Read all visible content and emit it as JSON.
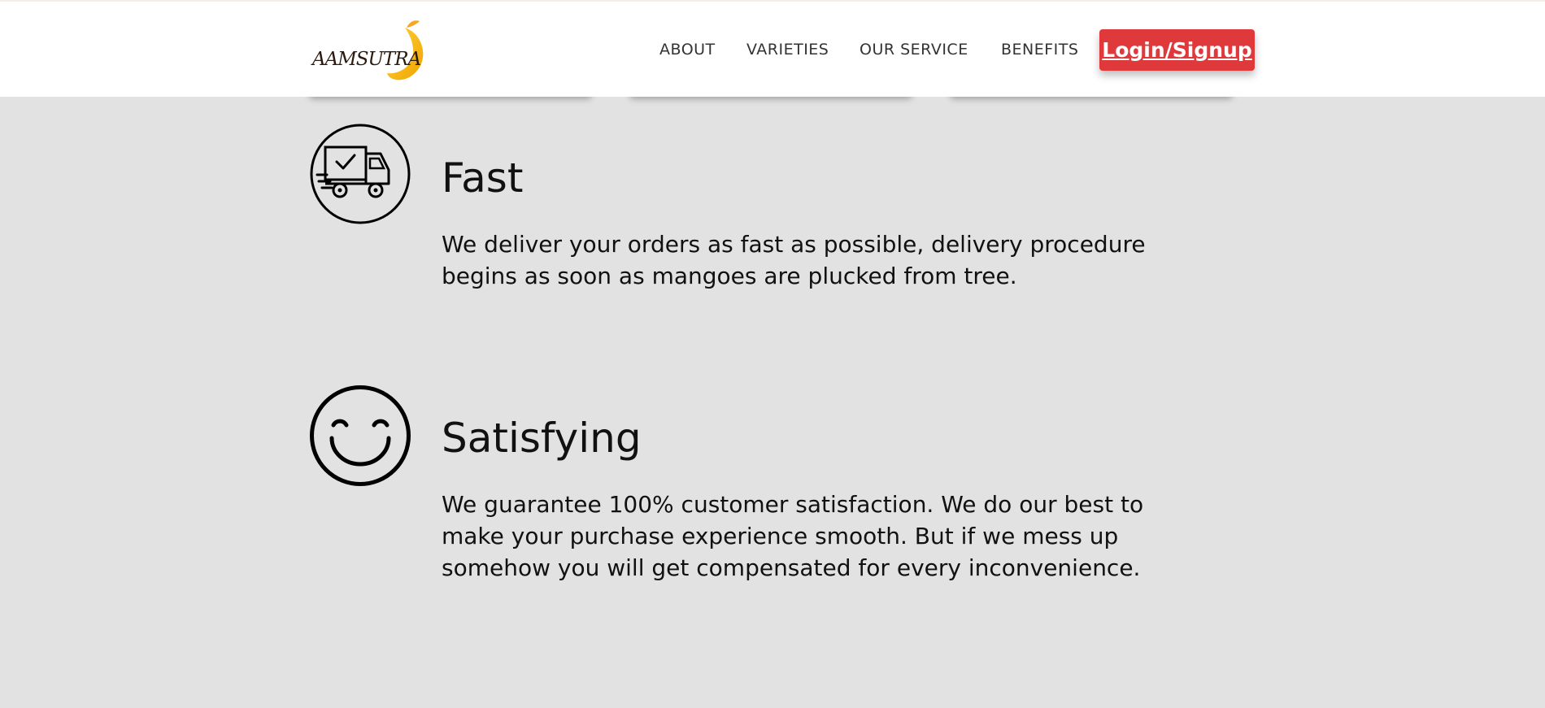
{
  "header": {
    "logo_text": "AAMSUTRA",
    "nav": [
      {
        "label": "ABOUT"
      },
      {
        "label": "VARIETIES"
      },
      {
        "label": "OUR SERVICE"
      },
      {
        "label": "BENEFITS"
      }
    ],
    "login_label": "Login/Signup"
  },
  "colors": {
    "background": "#e2e2e2",
    "header_bg": "#ffffff",
    "login_button": "#e0393b",
    "logo_mango": "#f5b80f"
  },
  "features": [
    {
      "icon": "delivery-truck-icon",
      "title": "Fast",
      "description": "We deliver your orders as fast as possible, delivery procedure begins as soon as mangoes are plucked from tree."
    },
    {
      "icon": "smiley-face-icon",
      "title": "Satisfying",
      "description": "We guarantee 100% customer satisfaction. We do our best to make your purchase experience smooth. But if we mess up somehow you will get compensated for every inconvenience."
    }
  ]
}
